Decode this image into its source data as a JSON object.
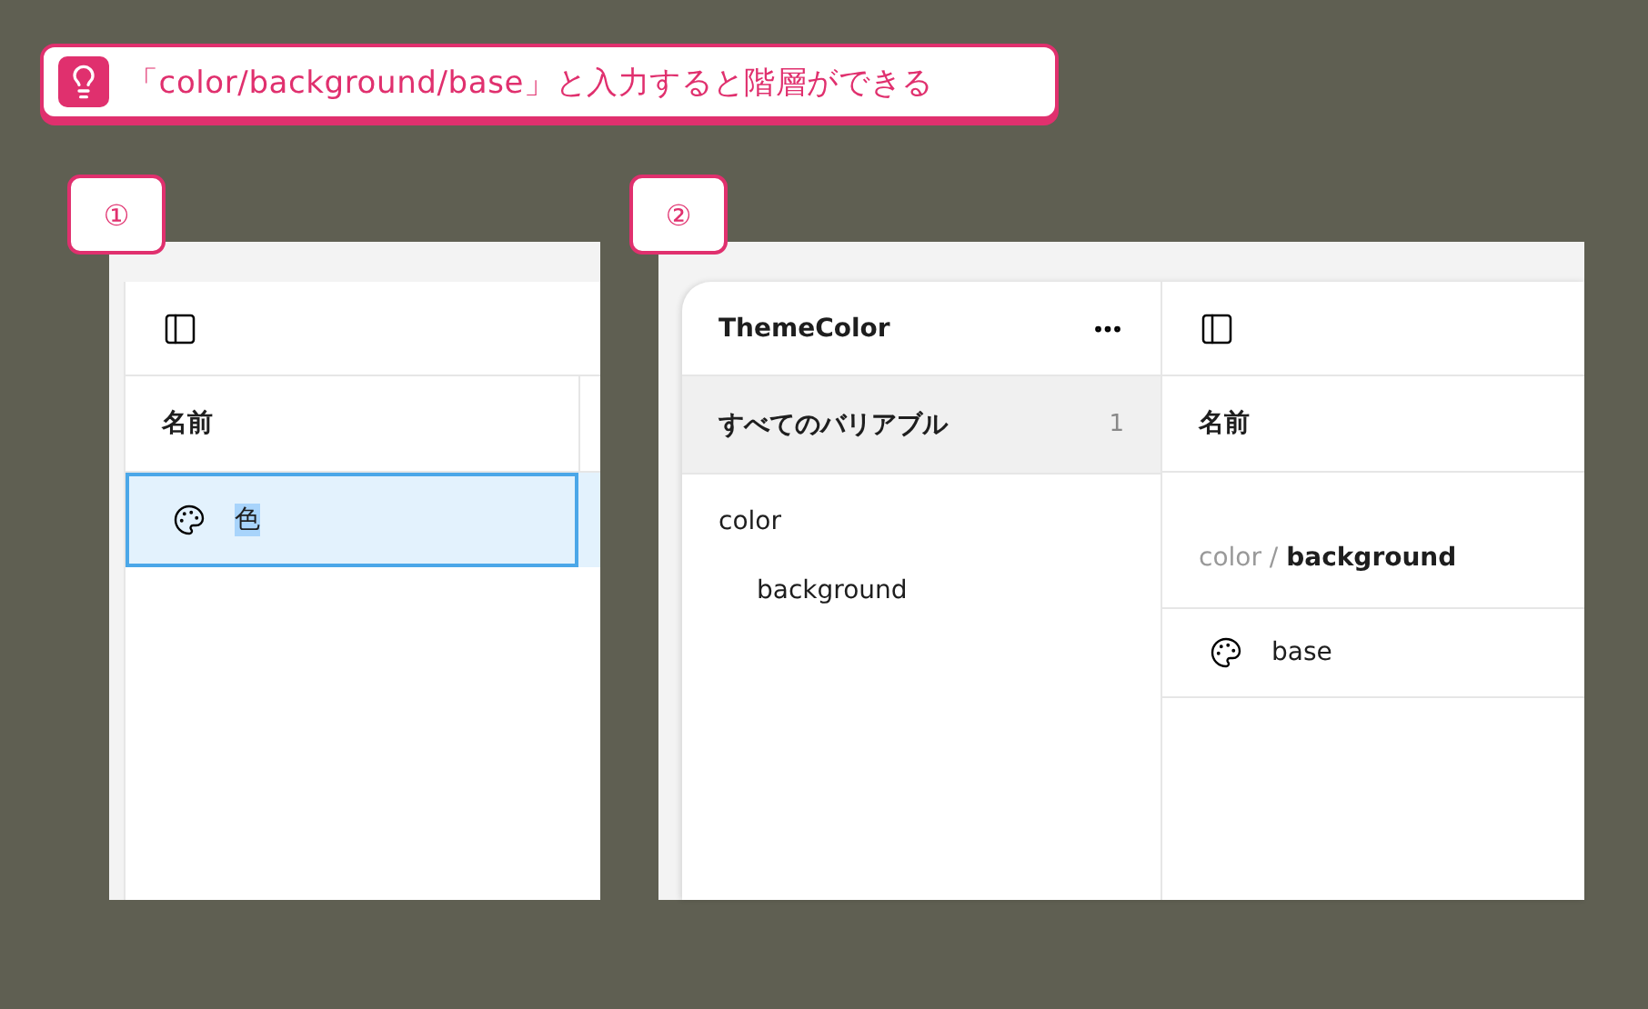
{
  "callout": {
    "text": "「color/background/base」と入力すると階層ができる"
  },
  "step_1": {
    "badge": "①",
    "column_header": "名前",
    "rows": [
      {
        "name": "色",
        "selected": true,
        "editing": true
      }
    ]
  },
  "step_2": {
    "badge": "②",
    "collection": {
      "title": "ThemeColor",
      "groups": [
        {
          "label": "すべてのバリアブル",
          "count": "1",
          "selected": true
        }
      ],
      "tree": [
        {
          "label": "color",
          "children": [
            {
              "label": "background"
            }
          ]
        }
      ]
    },
    "column_header": "名前",
    "group_header": "color / **background**",
    "rows": [
      {
        "name": "base",
        "selected": false,
        "editing": false
      }
    ]
  }
}
